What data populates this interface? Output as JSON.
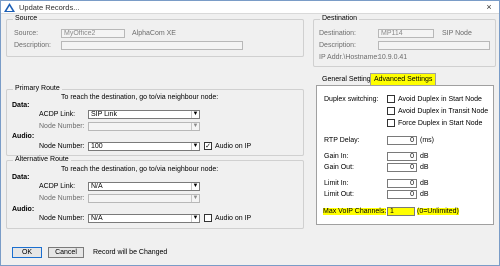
{
  "window": {
    "title": "Update Records...",
    "close_icon": "×"
  },
  "source": {
    "title": "Source",
    "source_label": "Source:",
    "source_value": "MyOffice2",
    "source_type": "AlphaCom XE",
    "description_label": "Description:",
    "description_value": ""
  },
  "destination": {
    "title": "Destination",
    "destination_label": "Destination:",
    "destination_value": "MP114",
    "destination_type": "SIP Node",
    "description_label": "Description:",
    "description_value": "",
    "ip_label": "IP Addr.\\Hostname:",
    "ip_value": "10.9.0.41"
  },
  "primary_route": {
    "title": "Primary Route",
    "instruction": "To reach the destination, go to/via neighbour node:",
    "data_label": "Data:",
    "acdp_link_label": "ACDP Link:",
    "acdp_link_value": "SIP Link",
    "node_number_label": "Node Number:",
    "node_number_value": "",
    "audio_label": "Audio:",
    "audio_node_number_label": "Node Number:",
    "audio_node_number_value": "100",
    "audio_on_ip_label": "Audio on IP",
    "audio_on_ip_checked": true
  },
  "alternative_route": {
    "title": "Alternative Route",
    "instruction": "To reach the destination, go to/via neighbour node:",
    "data_label": "Data:",
    "acdp_link_label": "ACDP Link:",
    "acdp_link_value": "N/A",
    "node_number_label": "Node Number:",
    "node_number_value": "",
    "audio_label": "Audio:",
    "audio_node_number_label": "Node Number:",
    "audio_node_number_value": "N/A",
    "audio_on_ip_label": "Audio on IP",
    "audio_on_ip_checked": false
  },
  "tabs": {
    "general": "General Settings",
    "advanced": "Advanced Settings"
  },
  "advanced": {
    "duplex_label": "Duplex switching:",
    "avoid_start": "Avoid Duplex in Start Node",
    "avoid_transit": "Avoid Duplex in Transit Node",
    "force_start": "Force Duplex in Start Node",
    "rtp_delay_label": "RTP Delay:",
    "rtp_delay_value": "0",
    "rtp_delay_unit": "(ms)",
    "gain_in_label": "Gain In:",
    "gain_in_value": "0",
    "gain_out_label": "Gain Out:",
    "gain_out_value": "0",
    "limit_in_label": "Limit In:",
    "limit_in_value": "0",
    "limit_out_label": "Limit Out:",
    "limit_out_value": "0",
    "db_unit": "dB",
    "max_voip_label": "Max VoIP Channels:",
    "max_voip_value": "1",
    "max_voip_hint": "(0=Unlimited)"
  },
  "footer": {
    "ok_label": "OK",
    "cancel_label": "Cancel",
    "status_text": "Record will be Changed"
  },
  "colors": {
    "highlight": "#ffff00",
    "window_border": "#7a9cc7"
  }
}
